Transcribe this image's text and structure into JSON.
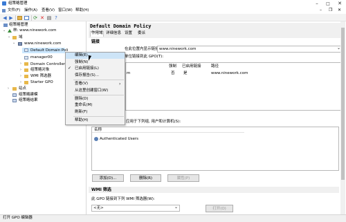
{
  "window": {
    "title": "组策略管理"
  },
  "menubar": {
    "items": [
      "文件(F)",
      "操作(A)",
      "查看(V)",
      "窗口(W)",
      "帮助(H)"
    ]
  },
  "tree": {
    "root": "组策略管理",
    "forest": "林: www.ninework.com",
    "domains": "域",
    "domain": "www.ninework.com",
    "items": [
      "Default Domain Poli",
      "manager00",
      "Domain Controllers",
      "组策略对象",
      "WMI 筛选器",
      "Starter GPO"
    ],
    "sites": "站点",
    "modeling": "组策略建模",
    "results": "组策略结果"
  },
  "context_menu": {
    "items": [
      "编辑(E)...",
      "强制(N)",
      "已启用链接(L)",
      "保存报告(S)...",
      "查看(V)",
      "从这里创建窗口(W)",
      "删除(D)",
      "重命名(M)",
      "刷新(F)",
      "帮助(H)"
    ],
    "checked": "已启用链接(L)"
  },
  "gpo": {
    "title": "Default Domain Policy",
    "tabs": [
      "作用域",
      "详细信息",
      "设置",
      "委派"
    ],
    "links_heading": "链接",
    "show_links_label": "在此位置内显示链接(L):",
    "location_value": "www.ninework.com",
    "linked_label": "单位链接到此 GPO(T):",
    "links_table": {
      "headers": [
        "强制",
        "已启用链接",
        "路径"
      ],
      "row": {
        "location": "m",
        "enforced": "否",
        "enabled": "是",
        "path": "www.ninework.com"
      }
    },
    "filter_label": "应用于下列组, 用户和计算机(S):",
    "security_header": "名称",
    "security_row": "Authenticated Users",
    "add_label": "添加(D)...",
    "remove_label": "删除(R)",
    "properties_label": "属性(P)",
    "wmi_heading": "WMI 筛选",
    "wmi_label": "此 GPO 链接到下列 WMI 筛选器(W):",
    "wmi_value": "<无>",
    "open_label": "打开(O)"
  },
  "status": {
    "text": "打开 GPO 编辑器"
  }
}
